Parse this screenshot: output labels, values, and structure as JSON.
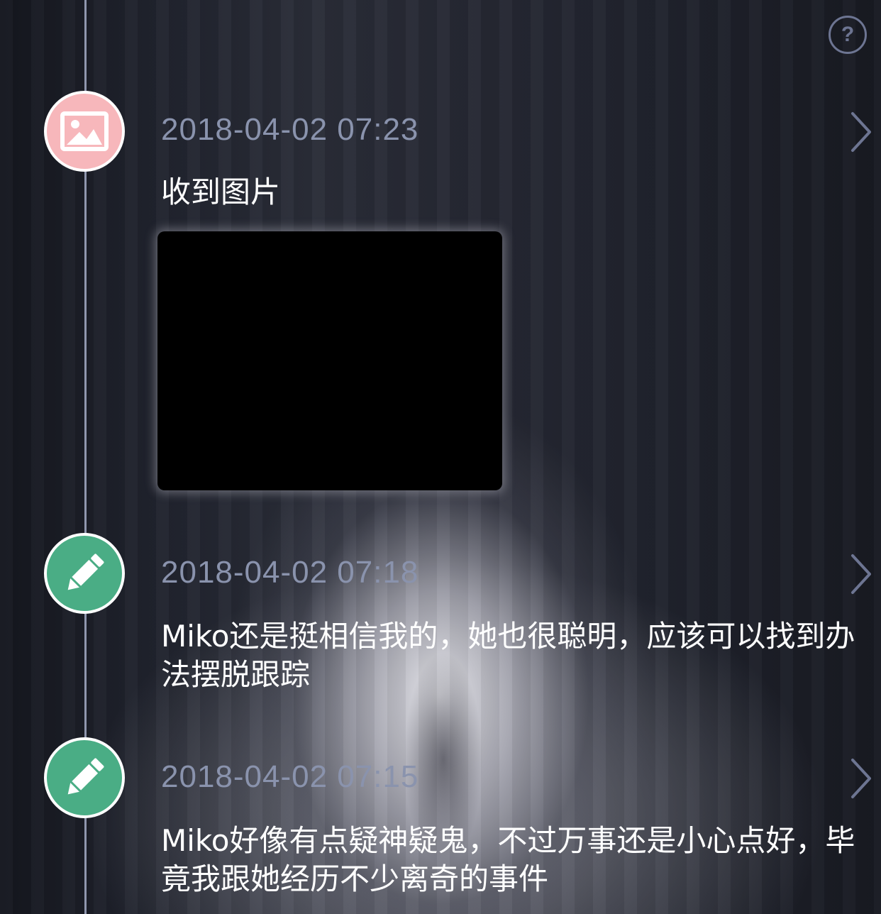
{
  "help": {
    "label": "?"
  },
  "entries": [
    {
      "type": "image",
      "time": "2018-04-02 07:23",
      "text": "收到图片",
      "node_color": "#f7b7bb"
    },
    {
      "type": "note",
      "time": "2018-04-02 07:18",
      "text": "Miko还是挺相信我的，她也很聪明，应该可以找到办法摆脱跟踪",
      "node_color": "#4aad85"
    },
    {
      "type": "note",
      "time": "2018-04-02 07:15",
      "text": "Miko好像有点疑神疑鬼，不过万事还是小心点好，毕竟我跟她经历不少离奇的事件",
      "node_color": "#4aad85"
    }
  ],
  "colors": {
    "timeline": "#8f96ad",
    "time_text": "#8a93ad",
    "body_text": "#ffffff",
    "icon_outline": "#6d7592"
  }
}
